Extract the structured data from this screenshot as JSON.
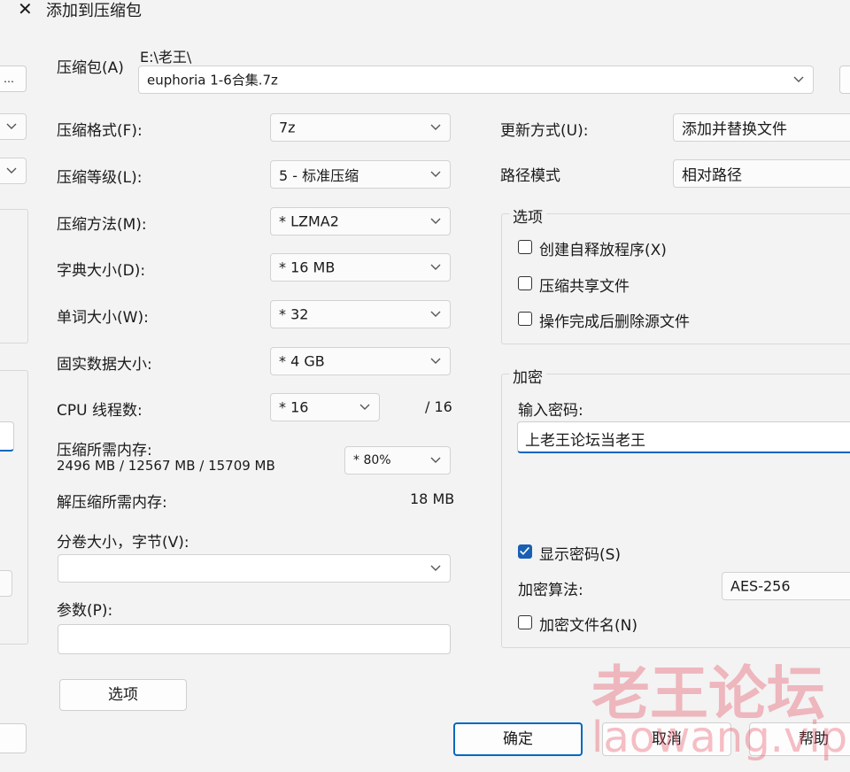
{
  "title": "添加到压缩包",
  "archive": {
    "label": "压缩包(A)",
    "path": "E:\\老王\\",
    "filename": "euphoria 1-6合集.7z",
    "browse_label": "..."
  },
  "left": {
    "format": {
      "label": "压缩格式(F):",
      "value": "7z"
    },
    "level": {
      "label": "压缩等级(L):",
      "value": "5 - 标准压缩"
    },
    "method": {
      "label": "压缩方法(M):",
      "value": "* LZMA2"
    },
    "dict": {
      "label": "字典大小(D):",
      "value": "* 16 MB"
    },
    "word": {
      "label": "单词大小(W):",
      "value": "* 32"
    },
    "solid": {
      "label": "固实数据大小:",
      "value": "* 4 GB"
    },
    "threads": {
      "label": "CPU 线程数:",
      "value": "* 16",
      "max": "/ 16"
    },
    "mem_compress": {
      "label": "压缩所需内存:",
      "detail": "2496 MB / 12567 MB / 15709 MB",
      "value": "* 80%"
    },
    "mem_decompress": {
      "label": "解压缩所需内存:",
      "value": "18 MB"
    },
    "volume": {
      "label": "分卷大小，字节(V):",
      "value": ""
    },
    "params": {
      "label": "参数(P):",
      "value": ""
    },
    "options_button": "选项"
  },
  "right": {
    "update_mode": {
      "label": "更新方式(U):",
      "value": "添加并替换文件"
    },
    "path_mode": {
      "label": "路径模式",
      "value": "相对路径"
    },
    "options": {
      "title": "选项",
      "items": [
        {
          "label": "创建自释放程序(X)",
          "checked": false
        },
        {
          "label": "压缩共享文件",
          "checked": false
        },
        {
          "label": "操作完成后删除源文件",
          "checked": false
        }
      ]
    },
    "encryption": {
      "title": "加密",
      "password_label": "输入密码:",
      "password_value": "上老王论坛当老王",
      "show_password": {
        "label": "显示密码(S)",
        "checked": true
      },
      "method_label": "加密算法:",
      "method_value": "AES-256",
      "encrypt_names": {
        "label": "加密文件名(N)",
        "checked": false
      }
    }
  },
  "buttons": {
    "ok": "确定",
    "cancel": "取消",
    "help": "帮助"
  },
  "watermark": {
    "line1": "老王论坛",
    "line2": "laowang.vip"
  }
}
